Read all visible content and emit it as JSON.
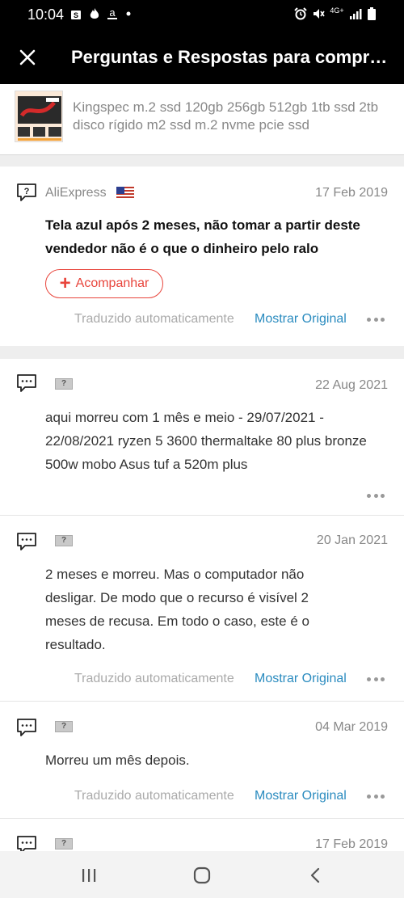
{
  "status_bar": {
    "time": "10:04",
    "left_icons": [
      "shopping-bag-icon",
      "fire-icon",
      "amazon-icon",
      "dot-icon"
    ],
    "right_icons": [
      "alarm-icon",
      "mute-icon",
      "4g-icon",
      "signal-icon",
      "battery-icon"
    ],
    "network_label": "4G+"
  },
  "header": {
    "title": "Perguntas e Respostas para compr…"
  },
  "product": {
    "title": "Kingspec m.2 ssd 120gb 256gb 512gb 1tb ssd 2tb disco rígido m2 ssd m.2 nvme pcie ssd"
  },
  "question": {
    "author": "AliExpress",
    "date": "17 Feb 2019",
    "text": "Tela azul após 2 meses, não tomar a partir deste vendedor não é o que o dinheiro pelo ralo",
    "follow_label": "Acompanhar",
    "auto_translated": "Traduzido automaticamente",
    "show_original": "Mostrar Original"
  },
  "answers": [
    {
      "date": "22 Aug 2021",
      "text": "aqui morreu com 1 mês e meio - 29/07/2021 - 22/08/2021 ryzen 5 3600 thermaltake 80 plus bronze 500w mobo Asus tuf a 520m plus"
    },
    {
      "date": "20 Jan 2021",
      "text": "2 meses e morreu. Mas o computador não desligar. De modo que o recurso é visível 2 meses de recusa. Em todo o caso, este é o resultado.",
      "auto_translated": "Traduzido automaticamente",
      "show_original": "Mostrar Original"
    },
    {
      "date": "04 Mar 2019",
      "text": "Morreu um mês depois.",
      "auto_translated": "Traduzido automaticamente",
      "show_original": "Mostrar Original"
    },
    {
      "date": "17 Feb 2019"
    }
  ],
  "avatar_placeholder": "?",
  "colors": {
    "accent_red": "#e8453c",
    "link_blue": "#2a8bbf",
    "header_bg": "#000000"
  },
  "nav_bar": {
    "buttons": [
      "recent-apps-icon",
      "home-icon",
      "back-icon"
    ]
  }
}
